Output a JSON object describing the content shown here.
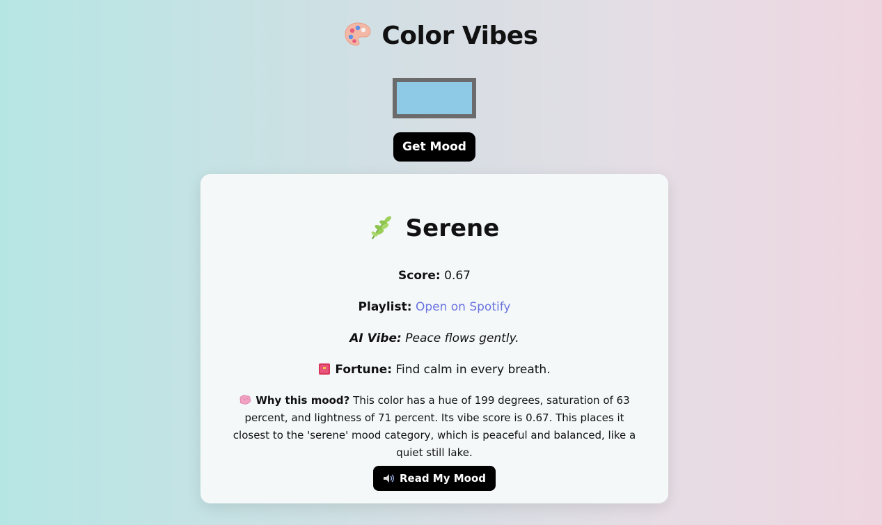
{
  "app": {
    "title": "Color Vibes",
    "title_icon": "palette-icon"
  },
  "color_picker": {
    "value": "#8ecae6"
  },
  "get_mood_button": {
    "label": "Get Mood"
  },
  "result": {
    "mood_icon": "herb-leaf-icon",
    "mood_name": "Serene",
    "score_label": "Score:",
    "score_value": "0.67",
    "playlist_label": "Playlist:",
    "playlist_link_text": "Open on Spotify",
    "ai_vibe_label": "AI Vibe:",
    "ai_vibe_text": "Peace flows gently.",
    "fortune_icon": "book-icon",
    "fortune_label": "Fortune:",
    "fortune_text": "Find calm in every breath.",
    "why_icon": "brain-icon",
    "why_label": "Why this mood?",
    "why_text": "This color has a hue of 199 degrees, saturation of 63 percent, and lightness of 71 percent. Its vibe score is 0.67. This places it closest to the 'serene' mood category, which is peaceful and balanced, like a quiet still lake.",
    "read_button_icon": "speaker-icon",
    "read_button_label": "Read My Mood"
  },
  "colors": {
    "swatch": "#8ecae6",
    "swatch_border": "#6b6b6b",
    "link": "#6b74e0",
    "button_bg": "#000000",
    "card_bg": "#f4f8f9"
  }
}
